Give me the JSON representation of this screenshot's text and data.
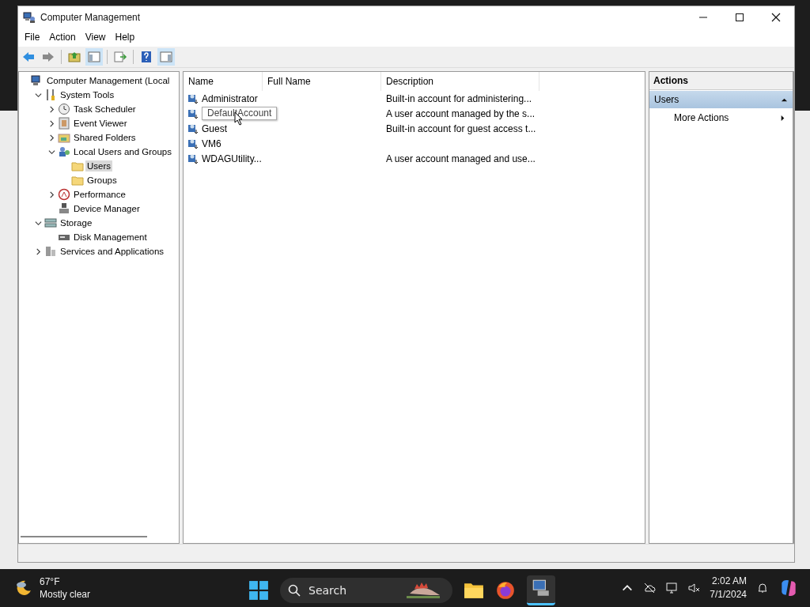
{
  "window": {
    "title": "Computer Management"
  },
  "menu": [
    "File",
    "Action",
    "View",
    "Help"
  ],
  "tree": [
    {
      "label": "Computer Management (Local",
      "selected": false,
      "children": [
        {
          "label": "System Tools",
          "selected": false,
          "expanded": true,
          "children": [
            {
              "label": "Task Scheduler",
              "selected": false,
              "expanded": false
            },
            {
              "label": "Event Viewer",
              "selected": false,
              "expanded": false
            },
            {
              "label": "Shared Folders",
              "selected": false,
              "expanded": false
            },
            {
              "label": "Local Users and Groups",
              "selected": false,
              "expanded": true,
              "children": [
                {
                  "label": "Users",
                  "selected": true
                },
                {
                  "label": "Groups",
                  "selected": false
                }
              ]
            },
            {
              "label": "Performance",
              "selected": false,
              "expanded": false
            },
            {
              "label": "Device Manager",
              "selected": false
            }
          ]
        },
        {
          "label": "Storage",
          "selected": false,
          "expanded": true,
          "children": [
            {
              "label": "Disk Management",
              "selected": false
            }
          ]
        },
        {
          "label": "Services and Applications",
          "selected": false,
          "expanded": false
        }
      ]
    }
  ],
  "table": {
    "columns": [
      "Name",
      "Full Name",
      "Description"
    ],
    "rows": [
      {
        "name": "Administrator",
        "description": "Built-in account for administering...",
        "tooltip": false
      },
      {
        "name": "DefaultAccount",
        "description": "A user account managed by the s...",
        "tooltip": true
      },
      {
        "name": "Guest",
        "description": "Built-in account for guest access t...",
        "tooltip": false
      },
      {
        "name": "VM6",
        "description": "",
        "tooltip": false
      },
      {
        "name": "WDAGUtility...",
        "description": "A user account managed and use...",
        "tooltip": false
      }
    ]
  },
  "actions": {
    "title": "Actions",
    "sections": [
      {
        "label": "Users",
        "expanded": true,
        "items": [
          "More Actions"
        ]
      }
    ]
  },
  "taskbar": {
    "temperature": "67°F",
    "weather": "Mostly clear",
    "search": {
      "placeholder": "Search"
    },
    "time": "2:02 AM",
    "date": "7/1/2024"
  }
}
